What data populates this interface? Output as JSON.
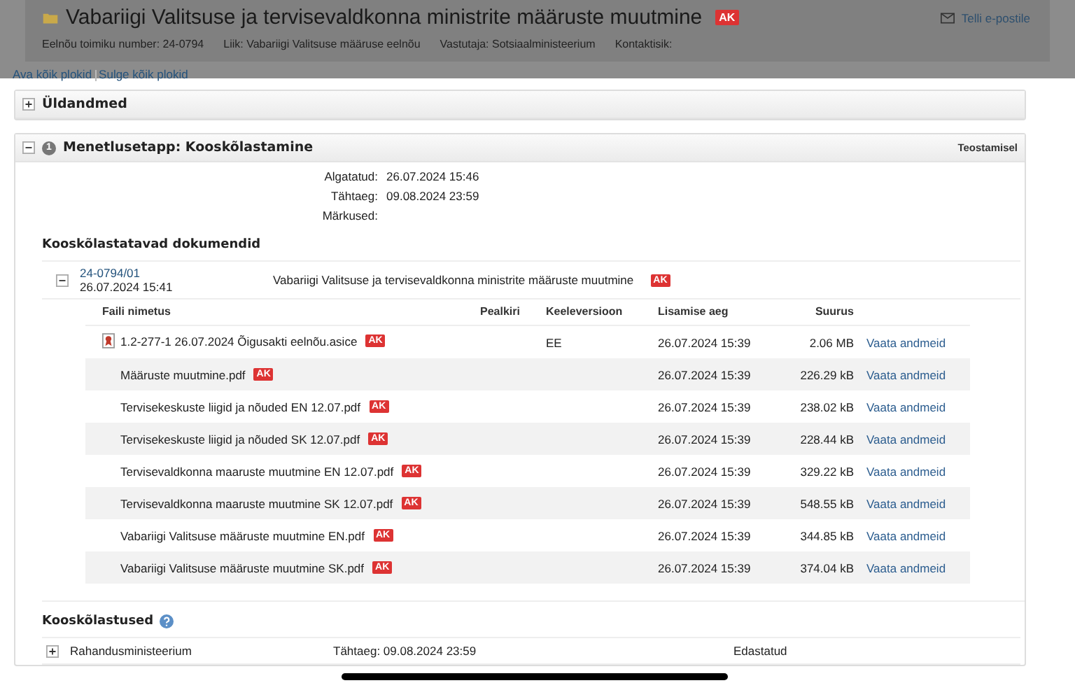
{
  "header": {
    "title": "Vabariigi Valitsuse ja tervisevaldkonna ministrite määruste muutmine",
    "badge": "AK",
    "email_link": "Telli e-postile",
    "meta": [
      "Eelnõu toimiku number: 24-0794",
      "Liik: Vabariigi Valitsuse määruse eelnõu",
      "Vastutaja: Sotsiaalministeerium",
      "Kontaktisik:"
    ]
  },
  "links": [
    "Ava kõik plokid",
    "Sulge kõik plokid"
  ],
  "general": {
    "title": "Üldandmed",
    "expanded": false
  },
  "stage": {
    "number": "1",
    "title": "Menetlusetapp: Kooskõlastamine",
    "status": "Teostamisel",
    "expanded": true,
    "fields": [
      {
        "label": "Algatatud:",
        "value": "26.07.2024 15:46"
      },
      {
        "label": "Tähtaeg:",
        "value": "09.08.2024 23:59"
      },
      {
        "label": "Märkused:"
      }
    ],
    "documents_heading": "Kooskõlastatavad dokumendid",
    "document": {
      "number": "24-0794/01",
      "date": "26.07.2024 15:41",
      "title": "Vabariigi Valitsuse ja tervisevaldkonna ministrite määruste muutmine",
      "badge": "AK",
      "expanded": true
    },
    "columns": [
      "Faili nimetus",
      "Pealkiri",
      "Keeleversioon",
      "Lisamise aeg",
      "Suurus"
    ],
    "files": [
      {
        "kind": "container",
        "name": "1.2-277-1 26.07.2024 Õigusakti eelnõu.asice",
        "badge": "AK",
        "language": "EE",
        "added": "26.07.2024 15:39",
        "size": "2.06 MB",
        "action": "Vaata andmeid"
      },
      {
        "kind": "file",
        "name": "Määruste muutmine.pdf",
        "badge": "AK",
        "added": "26.07.2024 15:39",
        "size": "226.29 kB",
        "action": "Vaata andmeid"
      },
      {
        "kind": "file",
        "name": "Tervisekeskuste liigid ja nõuded EN 12.07.pdf",
        "badge": "AK",
        "added": "26.07.2024 15:39",
        "size": "238.02 kB",
        "action": "Vaata andmeid"
      },
      {
        "kind": "file",
        "name": "Tervisekeskuste liigid ja nõuded SK 12.07.pdf",
        "badge": "AK",
        "added": "26.07.2024 15:39",
        "size": "228.44 kB",
        "action": "Vaata andmeid"
      },
      {
        "kind": "file",
        "name": "Tervisevaldkonna maaruste muutmine EN 12.07.pdf",
        "badge": "AK",
        "added": "26.07.2024 15:39",
        "size": "329.22 kB",
        "action": "Vaata andmeid"
      },
      {
        "kind": "file",
        "name": "Tervisevaldkonna maaruste muutmine SK 12.07.pdf",
        "badge": "AK",
        "added": "26.07.2024 15:39",
        "size": "548.55 kB",
        "action": "Vaata andmeid"
      },
      {
        "kind": "file",
        "name": "Vabariigi Valitsuse määruste muutmine EN.pdf",
        "badge": "AK",
        "added": "26.07.2024 15:39",
        "size": "344.85 kB",
        "action": "Vaata andmeid"
      },
      {
        "kind": "file",
        "name": "Vabariigi Valitsuse määruste muutmine SK.pdf",
        "badge": "AK",
        "added": "26.07.2024 15:39",
        "size": "374.04 kB",
        "action": "Vaata andmeid"
      }
    ],
    "approvals_heading": "Kooskõlastused",
    "approvals": [
      {
        "name": "Rahandusministeerium",
        "deadline": "Tähtaeg: 09.08.2024 23:59",
        "status": "Edastatud",
        "expanded": false
      }
    ]
  }
}
